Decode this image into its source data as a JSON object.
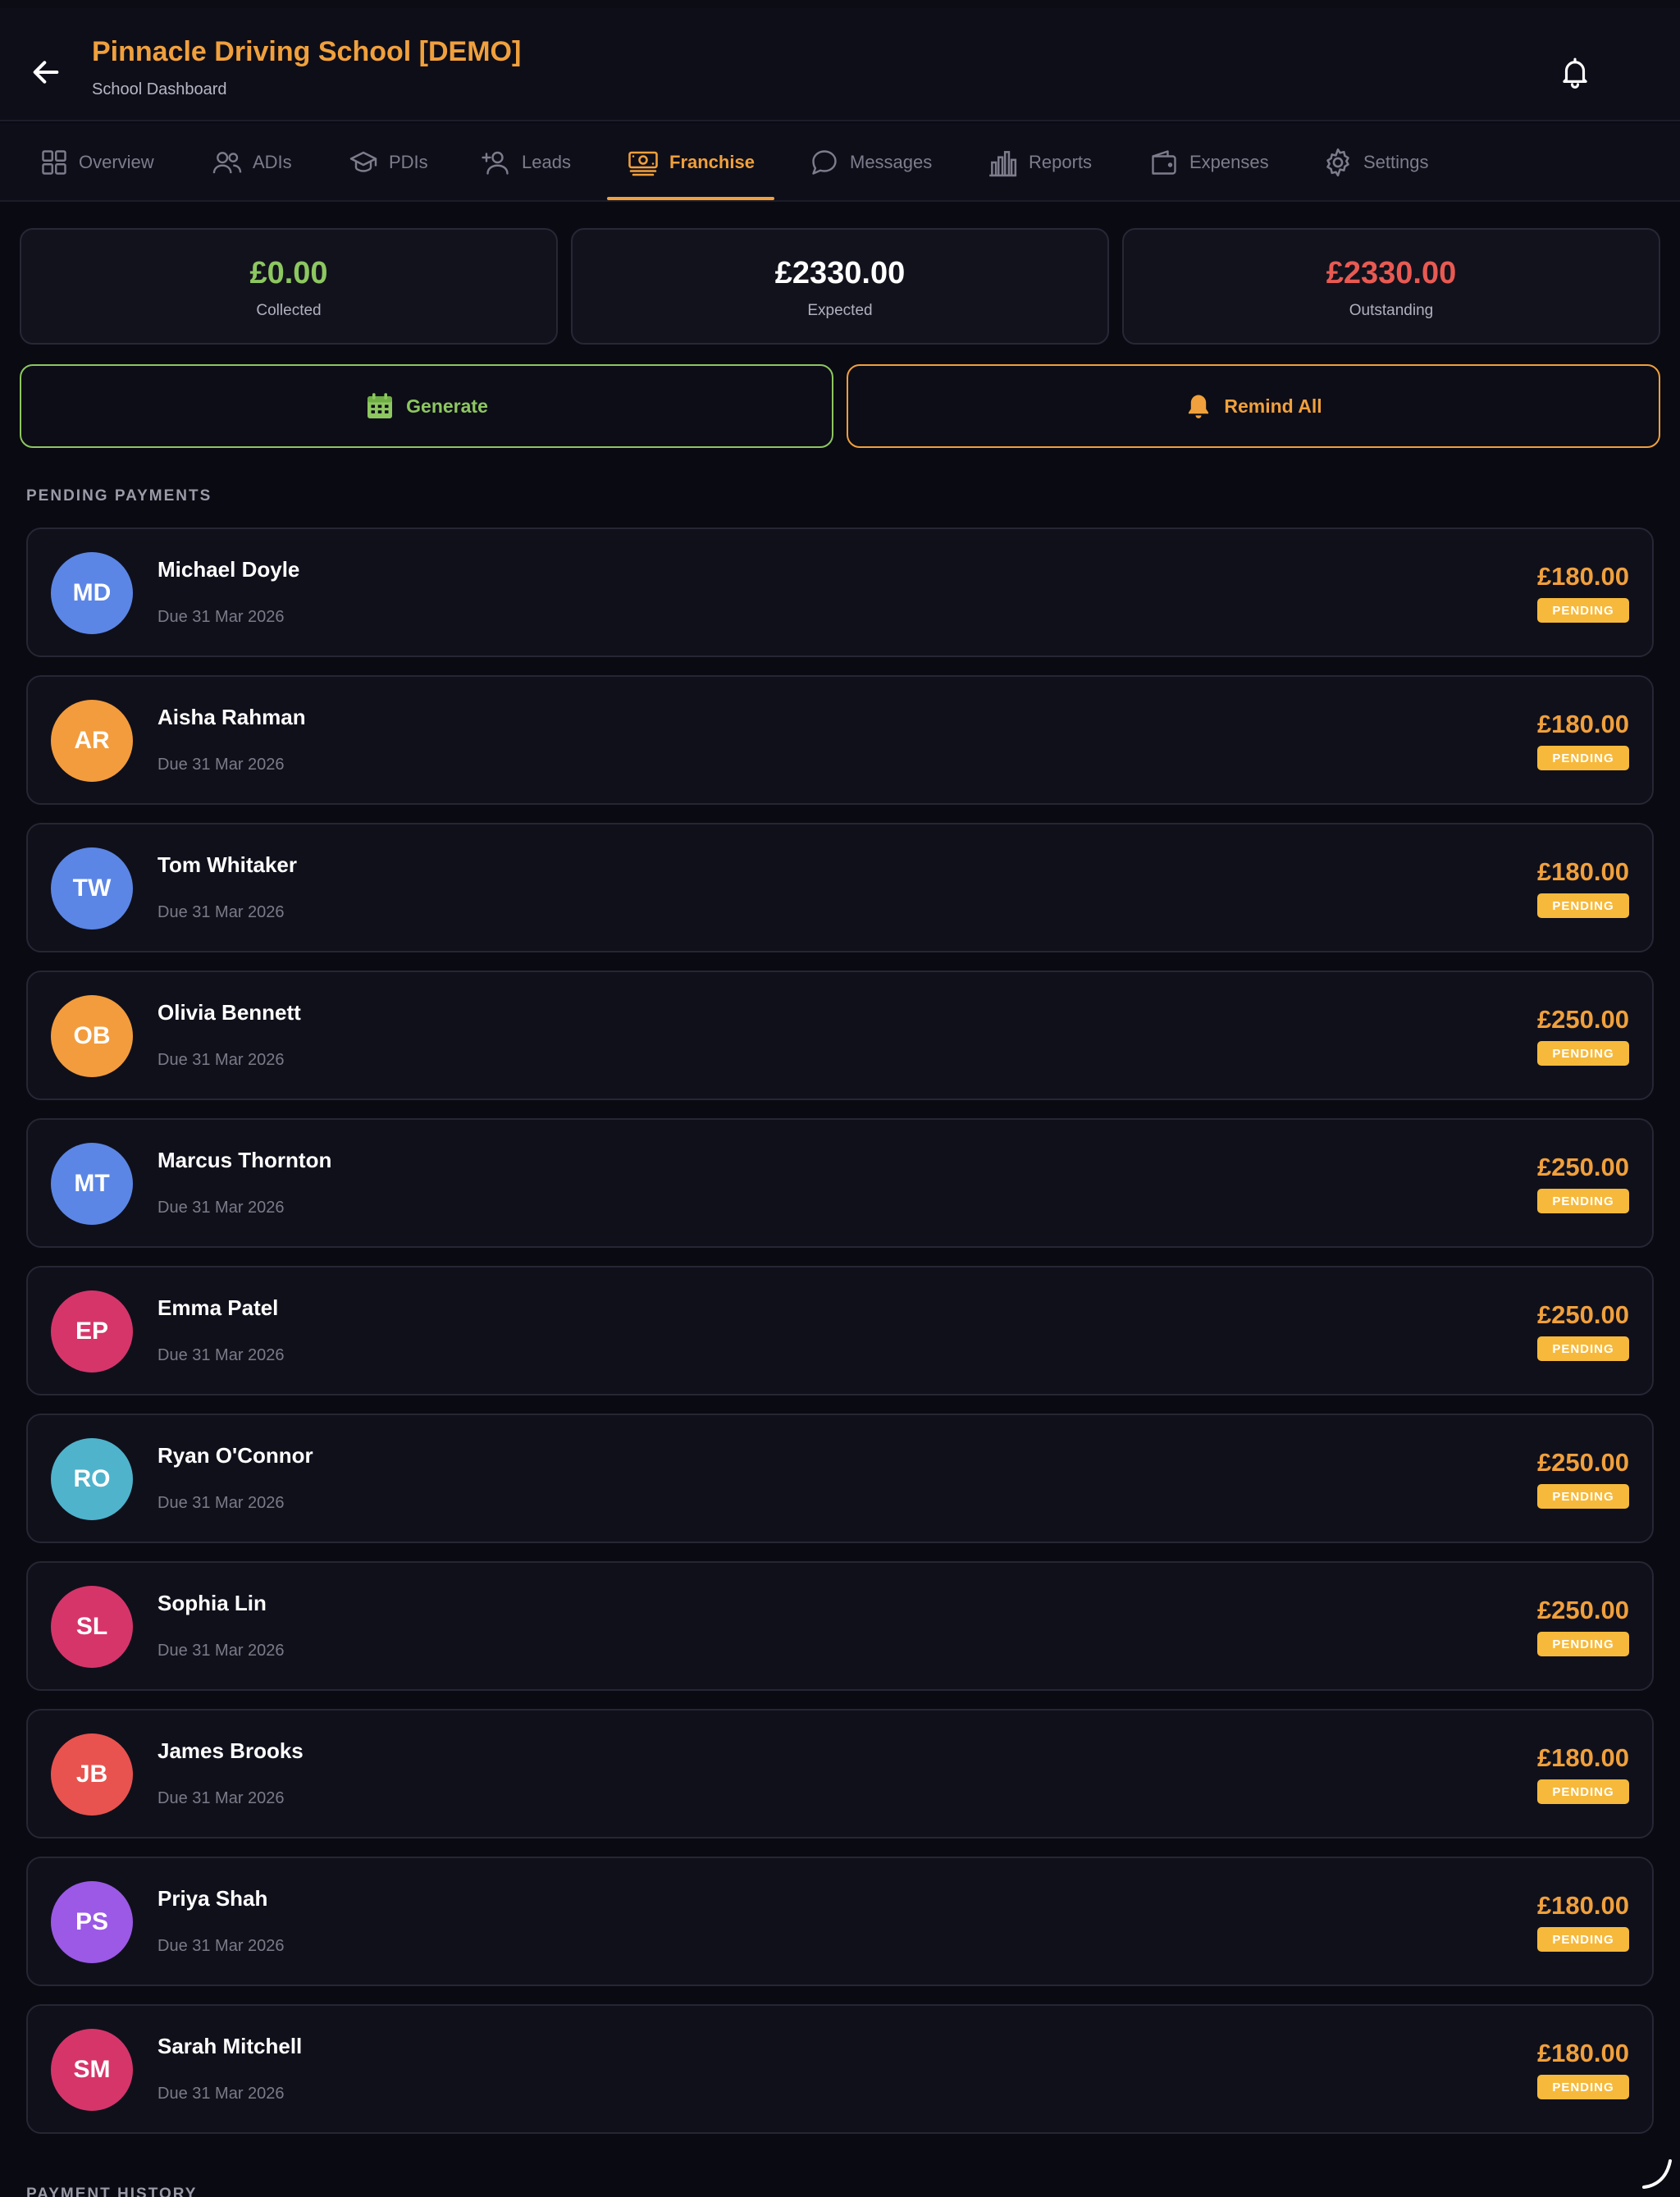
{
  "header": {
    "title": "Pinnacle Driving School [DEMO]",
    "subtitle": "School Dashboard",
    "back_icon": "arrow-left-icon",
    "bell_icon": "bell-icon"
  },
  "tabs": [
    {
      "label": "Overview",
      "icon": "grid-icon",
      "active": false
    },
    {
      "label": "ADIs",
      "icon": "users-icon",
      "active": false
    },
    {
      "label": "PDIs",
      "icon": "graduation-cap-icon",
      "active": false
    },
    {
      "label": "Leads",
      "icon": "user-plus-icon",
      "active": false
    },
    {
      "label": "Franchise",
      "icon": "banknote-icon",
      "active": true
    },
    {
      "label": "Messages",
      "icon": "chat-bubble-icon",
      "active": false
    },
    {
      "label": "Reports",
      "icon": "bar-chart-icon",
      "active": false
    },
    {
      "label": "Expenses",
      "icon": "wallet-icon",
      "active": false
    },
    {
      "label": "Settings",
      "icon": "gear-icon",
      "active": false
    }
  ],
  "summary": {
    "collected": {
      "value": "£0.00",
      "label": "Collected",
      "color": "#8dc760"
    },
    "expected": {
      "value": "£2330.00",
      "label": "Expected",
      "color": "#ffffff"
    },
    "outstanding": {
      "value": "£2330.00",
      "label": "Outstanding",
      "color": "#e85a52"
    }
  },
  "actions": {
    "generate_label": "Generate",
    "generate_icon": "calendar-icon",
    "remind_label": "Remind All",
    "remind_icon": "bell-filled-icon"
  },
  "pending_heading": "PENDING PAYMENTS",
  "history_heading": "PAYMENT HISTORY",
  "payments": [
    {
      "initials": "MD",
      "name": "Michael Doyle",
      "due": "Due 31 Mar 2026",
      "amount": "£180.00",
      "status": "PENDING",
      "avatar_color": "#5b86e5"
    },
    {
      "initials": "AR",
      "name": "Aisha Rahman",
      "due": "Due 31 Mar 2026",
      "amount": "£180.00",
      "status": "PENDING",
      "avatar_color": "#f39c3d"
    },
    {
      "initials": "TW",
      "name": "Tom Whitaker",
      "due": "Due 31 Mar 2026",
      "amount": "£180.00",
      "status": "PENDING",
      "avatar_color": "#5b86e5"
    },
    {
      "initials": "OB",
      "name": "Olivia Bennett",
      "due": "Due 31 Mar 2026",
      "amount": "£250.00",
      "status": "PENDING",
      "avatar_color": "#f39c3d"
    },
    {
      "initials": "MT",
      "name": "Marcus Thornton",
      "due": "Due 31 Mar 2026",
      "amount": "£250.00",
      "status": "PENDING",
      "avatar_color": "#5b86e5"
    },
    {
      "initials": "EP",
      "name": "Emma Patel",
      "due": "Due 31 Mar 2026",
      "amount": "£250.00",
      "status": "PENDING",
      "avatar_color": "#d6356a"
    },
    {
      "initials": "RO",
      "name": "Ryan O'Connor",
      "due": "Due 31 Mar 2026",
      "amount": "£250.00",
      "status": "PENDING",
      "avatar_color": "#4fb3cc"
    },
    {
      "initials": "SL",
      "name": "Sophia Lin",
      "due": "Due 31 Mar 2026",
      "amount": "£250.00",
      "status": "PENDING",
      "avatar_color": "#d6356a"
    },
    {
      "initials": "JB",
      "name": "James Brooks",
      "due": "Due 31 Mar 2026",
      "amount": "£180.00",
      "status": "PENDING",
      "avatar_color": "#e8534f"
    },
    {
      "initials": "PS",
      "name": "Priya Shah",
      "due": "Due 31 Mar 2026",
      "amount": "£180.00",
      "status": "PENDING",
      "avatar_color": "#9b59e6"
    },
    {
      "initials": "SM",
      "name": "Sarah Mitchell",
      "due": "Due 31 Mar 2026",
      "amount": "£180.00",
      "status": "PENDING",
      "avatar_color": "#d6356a"
    }
  ]
}
